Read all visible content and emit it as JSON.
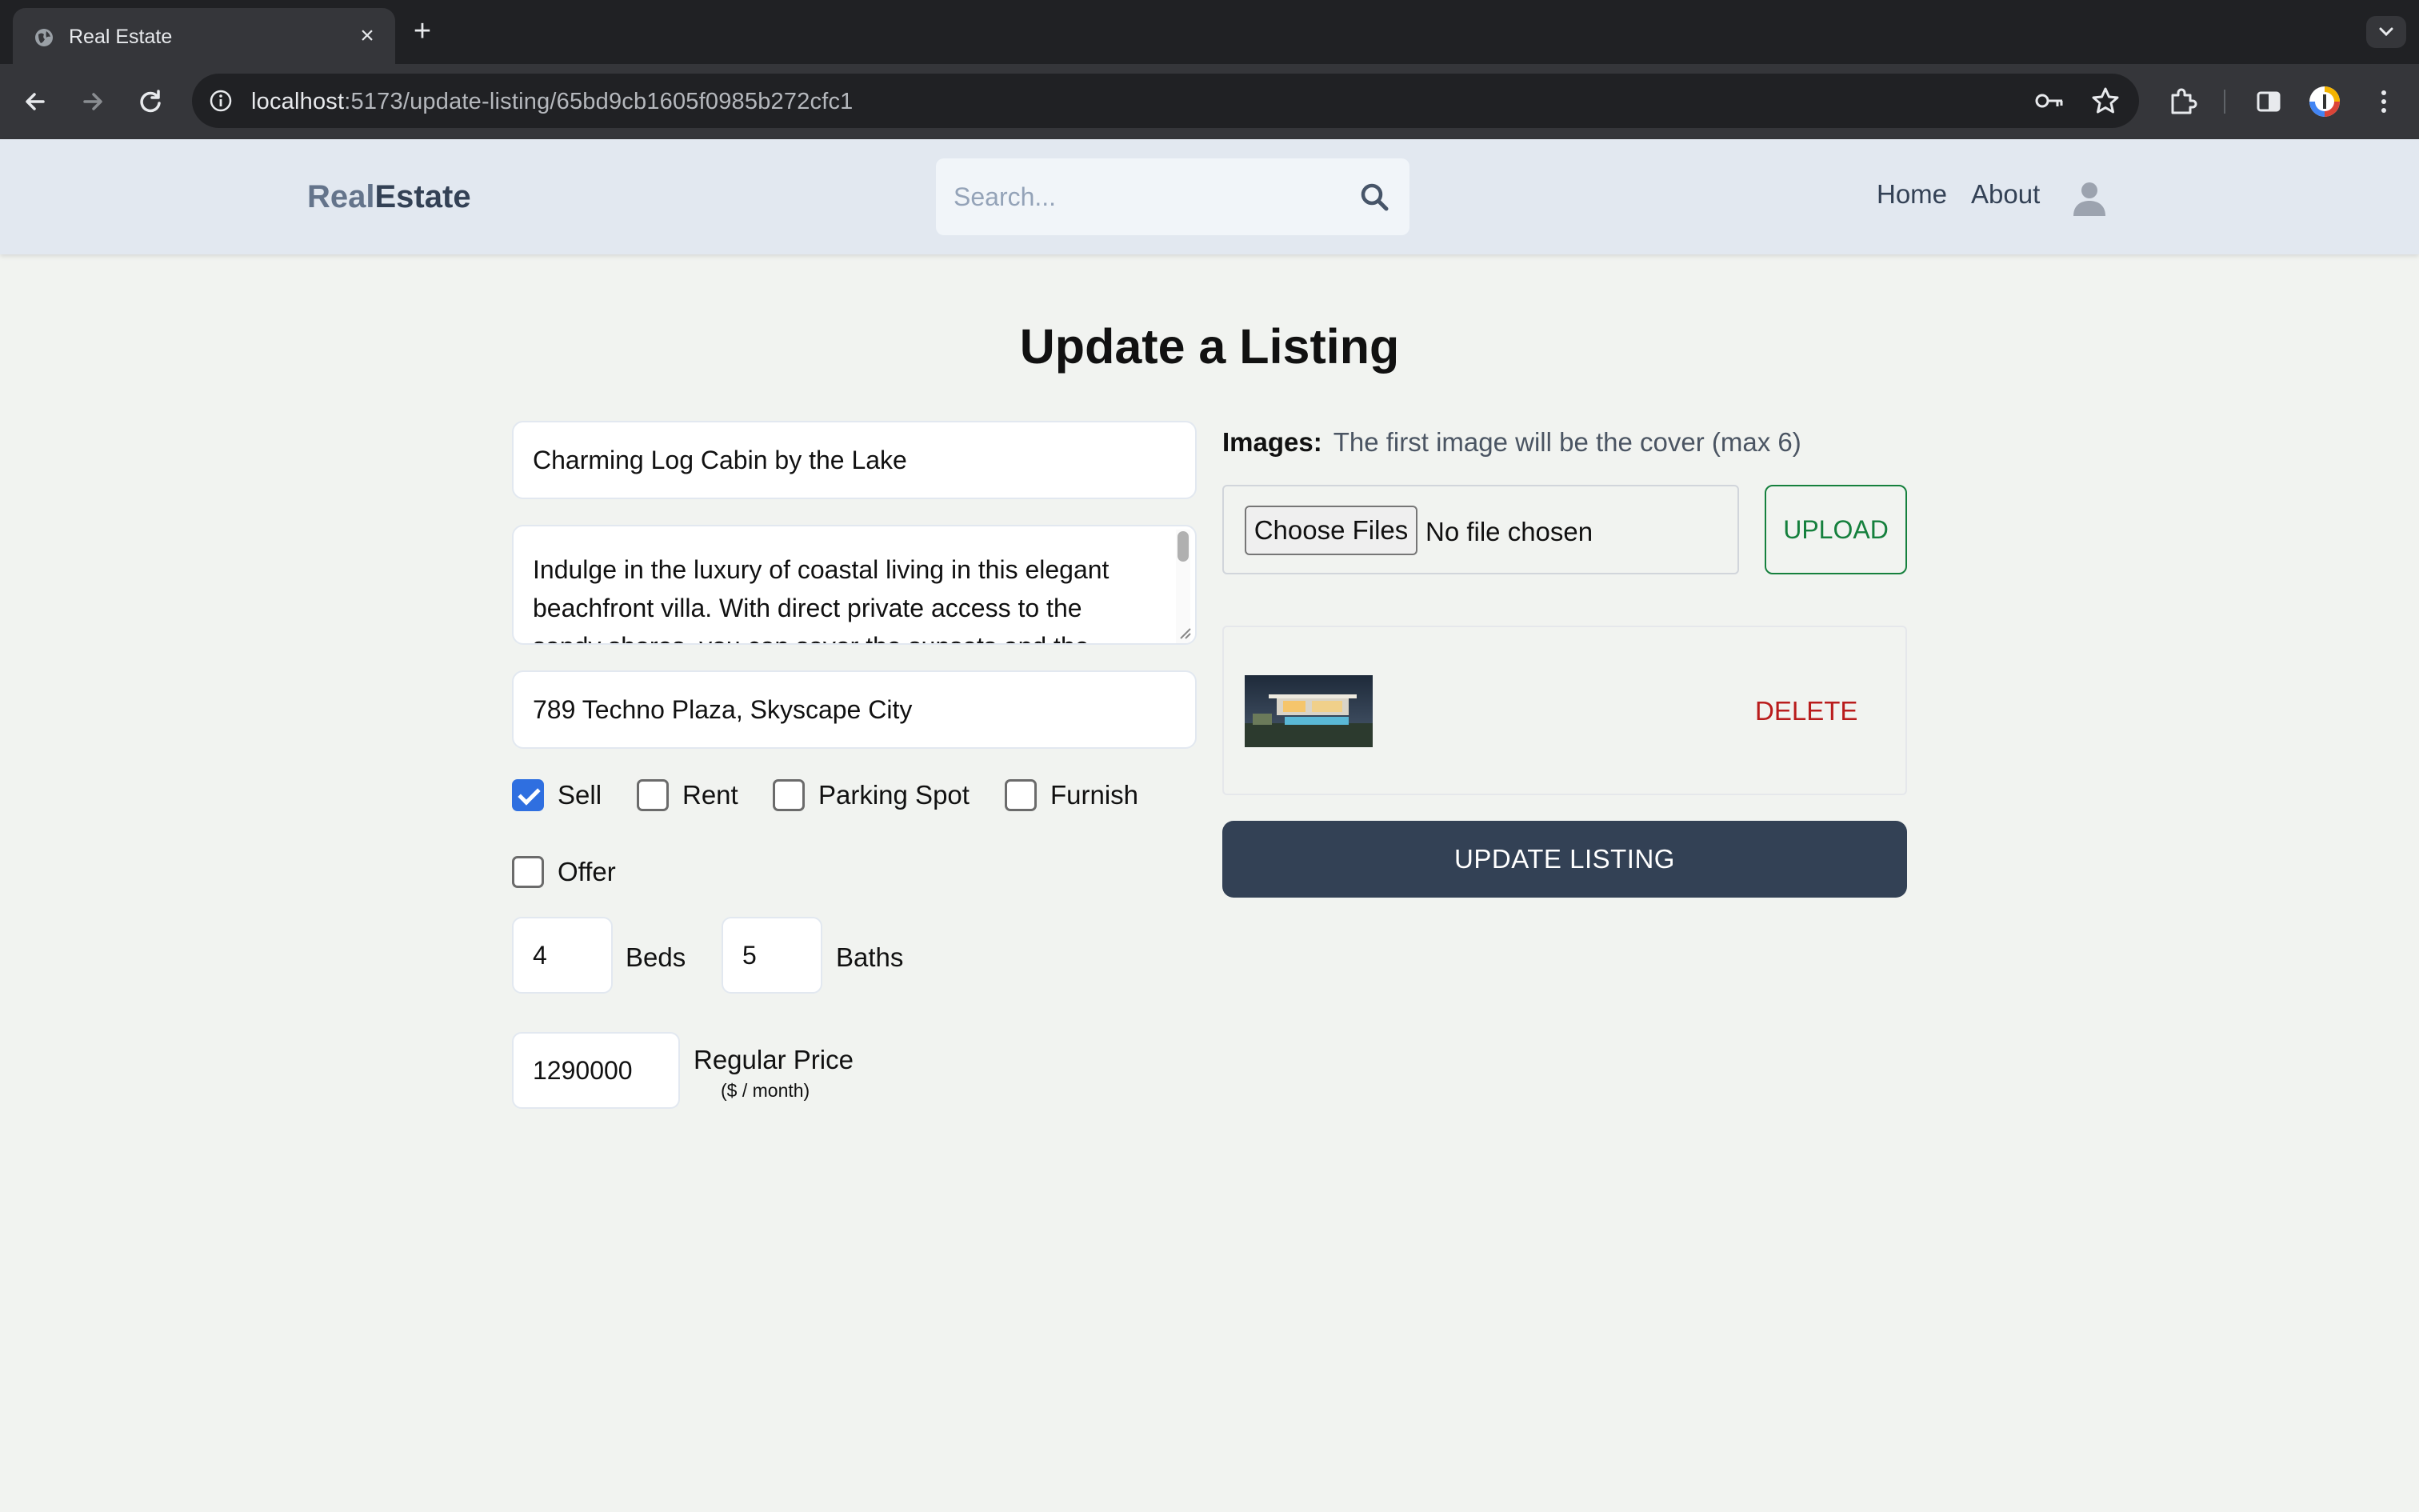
{
  "browser": {
    "tab_title": "Real Estate",
    "url_host": "localhost",
    "url_rest": ":5173/update-listing/65bd9cb1605f0985b272cfc1"
  },
  "header": {
    "logo_part1": "Real",
    "logo_part2": "Estate",
    "search_placeholder": "Search...",
    "nav": [
      "Home",
      "About"
    ]
  },
  "form": {
    "title": "Update a Listing",
    "name": "Charming Log Cabin by the Lake",
    "description": "Indulge in the luxury of coastal living in this elegant beachfront villa. With direct private access to the sandy shores, you can savor the sunsets and the",
    "address": "789 Techno Plaza, Skyscape City",
    "options": [
      {
        "label": "Sell",
        "checked": true
      },
      {
        "label": "Rent",
        "checked": false
      },
      {
        "label": "Parking Spot",
        "checked": false
      },
      {
        "label": "Furnish",
        "checked": false
      },
      {
        "label": "Offer",
        "checked": false
      }
    ],
    "beds": {
      "value": "4",
      "label": "Beds"
    },
    "baths": {
      "value": "5",
      "label": "Baths"
    },
    "price": {
      "value": "1290000",
      "label": "Regular Price",
      "unit": "($ / month)"
    }
  },
  "images": {
    "label": "Images:",
    "hint": "The first image will be the cover (max 6)",
    "choose_label": "Choose Files",
    "file_status": "No file chosen",
    "upload_label": "UPLOAD",
    "delete_label": "DELETE",
    "submit_label": "UPDATE LISTING"
  },
  "colors": {
    "header_bg": "#e2e8f0",
    "page_bg": "#f1f3f0",
    "primary": "#334155",
    "upload": "#15803d",
    "delete": "#b91c1c",
    "checkbox": "#2f6fe0"
  }
}
